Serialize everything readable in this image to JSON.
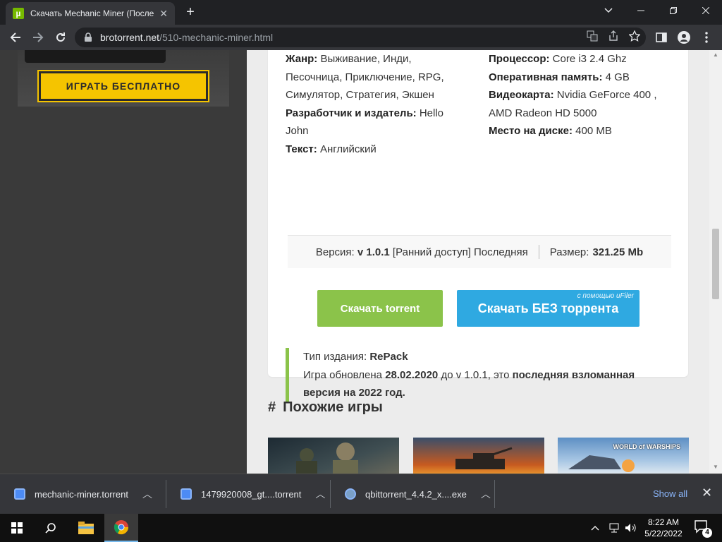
{
  "browser": {
    "tab_title": "Скачать Mechanic Miner (После",
    "tab_favicon_letter": "µ",
    "url_domain": "brotorrent.net",
    "url_path": "/510-mechanic-miner.html"
  },
  "ad": {
    "button_label": "ИГРАТЬ БЕСПЛАТНО"
  },
  "specs_left": [
    {
      "label": "Жанр:",
      "value": "Выживание, Инди, Песочница, Приключение, RPG, Симулятор, Стратегия, Экшен"
    },
    {
      "label": "Разработчик и издатель:",
      "value": "Hello John"
    },
    {
      "label": "Текст:",
      "value": "Английский"
    }
  ],
  "specs_right": [
    {
      "label": "Процессор:",
      "value": "Core i3 2.4 Ghz"
    },
    {
      "label": "Оперативная память:",
      "value": "4 GB"
    },
    {
      "label": "Видеокарта:",
      "value": "Nvidia GeForce 400 , AMD Radeon HD 5000"
    },
    {
      "label": "Место на диске:",
      "value": "400 MB"
    }
  ],
  "version_bar": {
    "version_label": "Версия:",
    "version_value": "v 1.0.1",
    "version_suffix": "[Ранний доступ] Последняя",
    "size_label": "Размер:",
    "size_value": "321.25 Mb"
  },
  "buttons": {
    "torrent": "Скачать torrent",
    "direct": "Скачать БЕЗ торрента",
    "direct_sub": "с помощью uFiler"
  },
  "release": {
    "type_label": "Тип издания:",
    "type_value": "RePack",
    "updated_prefix": "Игра обновлена",
    "updated_date": "28.02.2020",
    "updated_mid": "до v 1.0.1, это",
    "updated_bold": "последняя взломанная версия на 2022 год."
  },
  "similar": {
    "hash": "#",
    "title": "Похожие игры",
    "thumb3_logo": "WORLD of WARSHIPS"
  },
  "downloads": [
    {
      "name": "mechanic-miner.torrent"
    },
    {
      "name": "1479920008_gt....torrent"
    },
    {
      "name": "qbittorrent_4.4.2_x....exe"
    }
  ],
  "shelf": {
    "show_all": "Show all"
  },
  "taskbar": {
    "time": "8:22 AM",
    "date": "5/22/2022",
    "notifications": "4"
  }
}
